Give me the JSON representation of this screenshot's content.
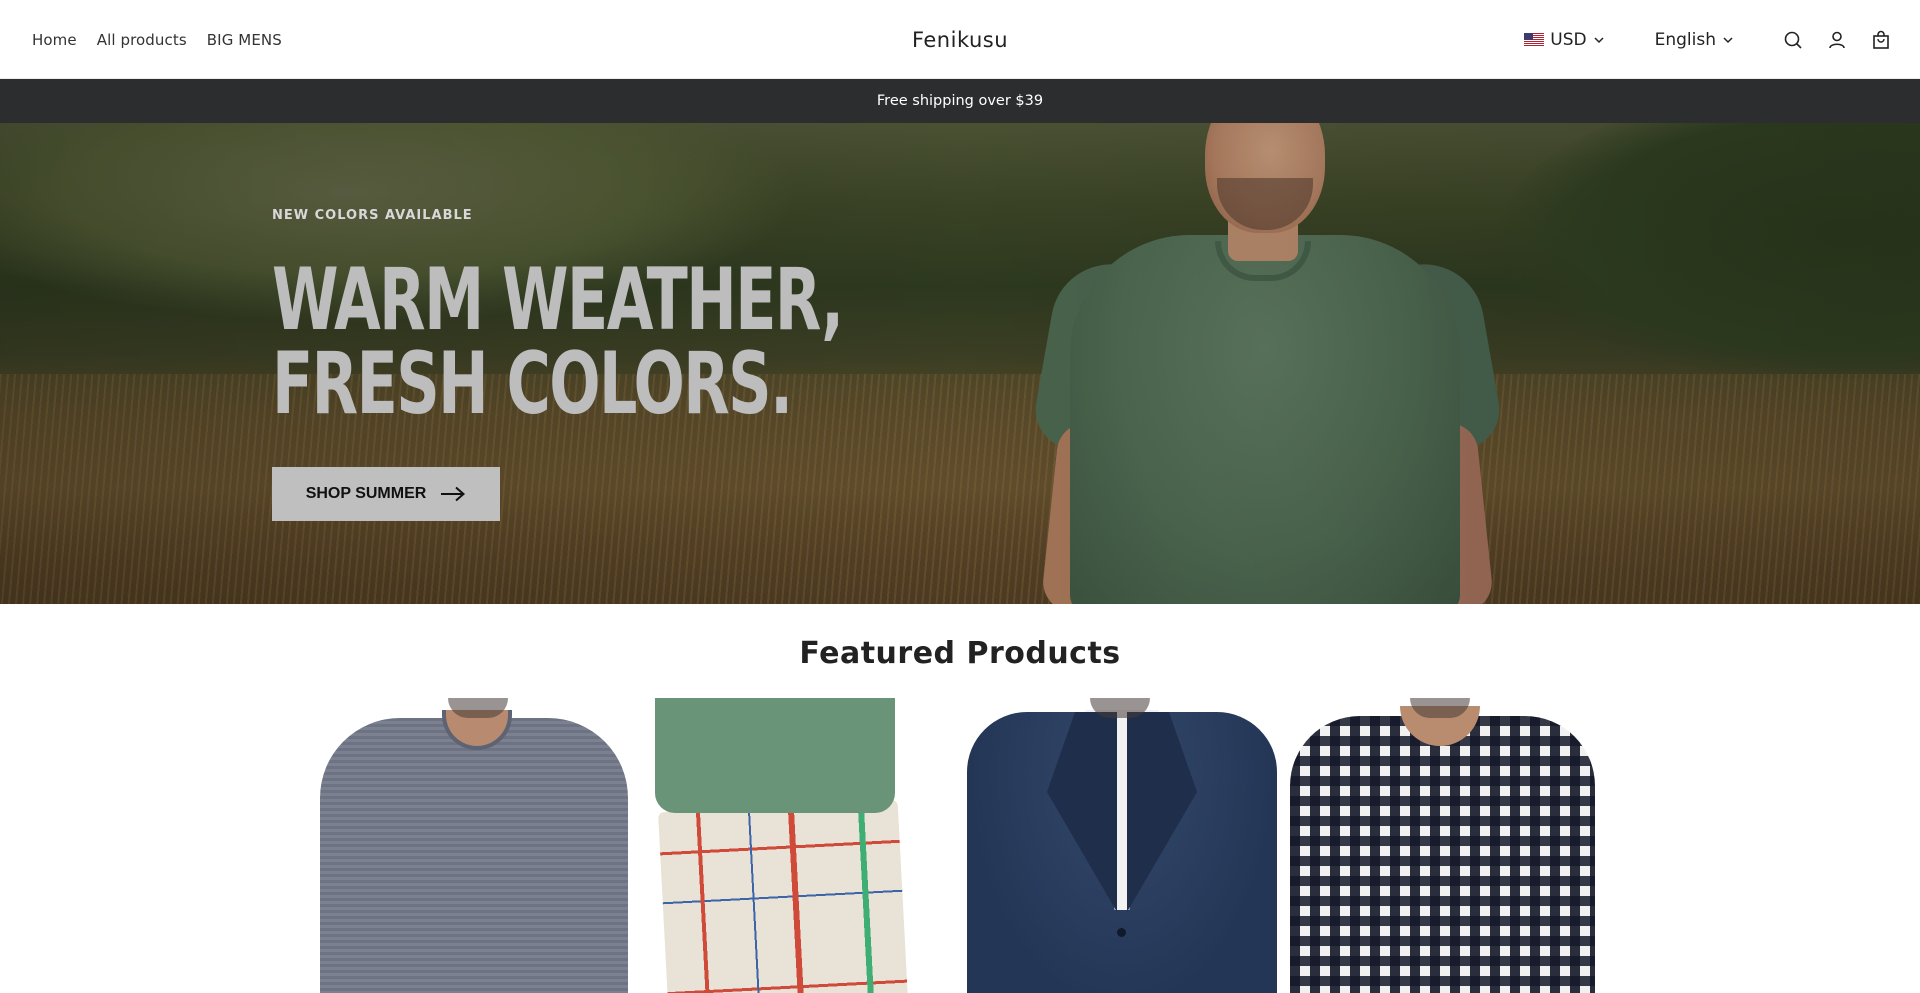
{
  "header": {
    "nav": [
      {
        "label": "Home"
      },
      {
        "label": "All products"
      },
      {
        "label": "BIG MENS"
      }
    ],
    "brand": "Fenikusu",
    "currency": {
      "selected": "USD",
      "flag": "us-flag-icon"
    },
    "language": {
      "selected": "English"
    },
    "icons": [
      "search-icon",
      "account-icon",
      "cart-icon"
    ]
  },
  "announcement": {
    "text": "Free shipping over $39"
  },
  "hero": {
    "eyebrow": "NEW COLORS AVAILABLE",
    "headline_line1": "WARM WEATHER,",
    "headline_line2": "FRESH COLORS.",
    "cta_label": "SHOP SUMMER",
    "cta_icon": "arrow-right-icon"
  },
  "featured": {
    "title": "Featured Products"
  },
  "colors": {
    "announcement_bg": "#2c2d2f",
    "cta_bg": "#bfbfbf",
    "headline": "#bdbdbd"
  }
}
